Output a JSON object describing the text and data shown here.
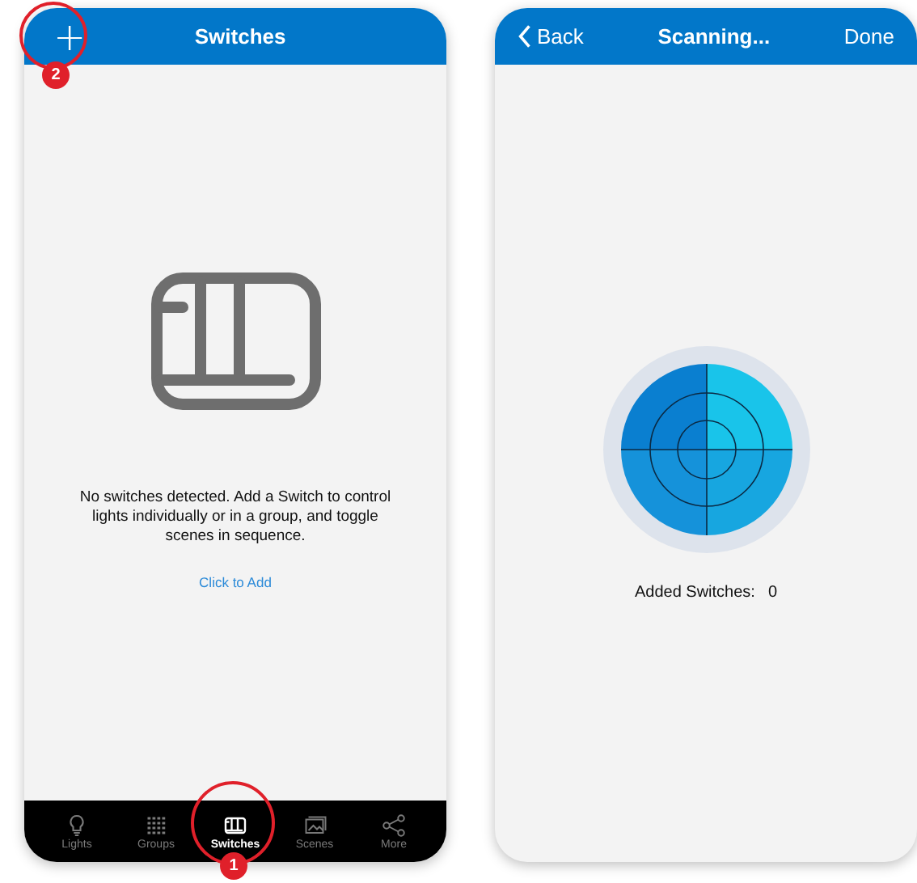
{
  "switches_screen": {
    "header": {
      "add_button": "+",
      "title": "Switches"
    },
    "empty_message": "No switches detected. Add a Switch to control lights individually or in a group, and toggle scenes in sequence.",
    "add_link": "Click to Add",
    "tabs": [
      {
        "label": "Lights",
        "kind": "bulb",
        "selected": false
      },
      {
        "label": "Groups",
        "kind": "grid",
        "selected": false
      },
      {
        "label": "Switches",
        "kind": "switch",
        "selected": true
      },
      {
        "label": "Scenes",
        "kind": "scene",
        "selected": false
      },
      {
        "label": "More",
        "kind": "share",
        "selected": false
      }
    ]
  },
  "scanning_screen": {
    "header": {
      "back": "Back",
      "title": "Scanning...",
      "done": "Done"
    },
    "added_label": "Added Switches:",
    "added_count": "0"
  },
  "callouts": [
    {
      "label": "2",
      "kind": "header"
    },
    {
      "label": "1",
      "kind": "tabbar"
    }
  ]
}
